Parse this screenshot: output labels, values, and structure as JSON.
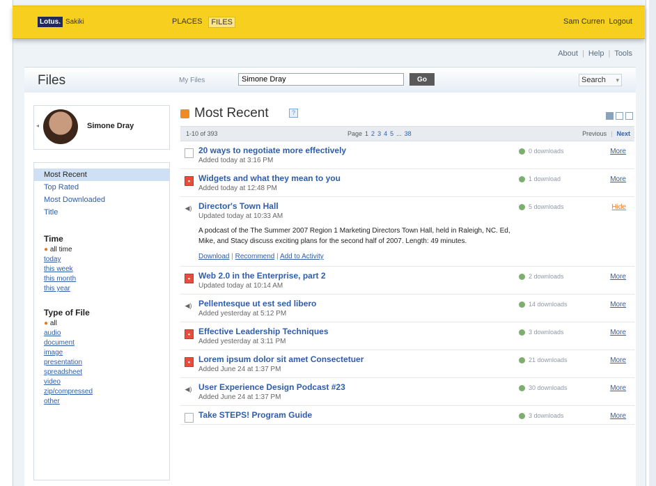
{
  "header": {
    "logo_brand": "Lotus.",
    "logo_product": "Sakiki",
    "nav": [
      {
        "label": "PLACES",
        "active": false
      },
      {
        "label": "FILES",
        "active": true
      }
    ],
    "user_name": "Sam Curren",
    "logout": "Logout"
  },
  "util_links": [
    "About",
    "Help",
    "Tools"
  ],
  "titlebar": {
    "title": "Files",
    "my_files": "My Files",
    "search_value": "Simone Dray",
    "go": "Go",
    "search": "Search"
  },
  "profile": {
    "name": "Simone Dray"
  },
  "sidebar": {
    "nav": [
      "Most Recent",
      "Top Rated",
      "Most Downloaded",
      "Title"
    ],
    "selected_nav": "Most Recent",
    "time": {
      "heading": "Time",
      "current": "all time",
      "links": [
        "today",
        "this week",
        "this month",
        "this year"
      ]
    },
    "type": {
      "heading": "Type of File",
      "current": "all",
      "links": [
        "audio",
        "document",
        "image",
        "presentation",
        "spreadsheet",
        "video",
        "zip/compressed",
        "other"
      ]
    }
  },
  "main": {
    "title": "Most Recent",
    "pager": {
      "count": "1-10 of 393",
      "page_label": "Page",
      "pages": [
        "1",
        "2",
        "3",
        "4",
        "5",
        "...",
        "38"
      ],
      "previous": "Previous",
      "next": "Next"
    },
    "files": [
      {
        "title": "20 ways to negotiate more effectively",
        "sub": "Added today at 3:16 PM",
        "downloads": "0 downloads",
        "action": "More",
        "icon": "document-icon"
      },
      {
        "title": "Widgets and what they mean to you",
        "sub": "Added today at 12:48 PM",
        "downloads": "1 download",
        "action": "More",
        "icon": "presentation-icon"
      },
      {
        "title": "Director's Town Hall",
        "sub": "Updated today at 10:33 AM",
        "downloads": "5 downloads",
        "action": "Hide",
        "icon": "audio-icon",
        "description": "A podcast of the The Summer 2007 Region 1 Marketing Directors Town Hall, held in Raleigh, NC. Ed, Mike, and Stacy discuss exciting plans for the second half of 2007. Length: 49 minutes.",
        "links": [
          "Download",
          "Recommend",
          "Add to Activity"
        ]
      },
      {
        "title": "Web 2.0 in the Enterprise, part 2",
        "sub": "Updated today at 10:14 AM",
        "downloads": "2 downloads",
        "action": "More",
        "icon": "presentation-icon"
      },
      {
        "title": "Pellentesque ut est sed libero",
        "sub": "Added yesterday at 5:12 PM",
        "downloads": "14 downloads",
        "action": "More",
        "icon": "audio-icon"
      },
      {
        "title": "Effective Leadership Techniques",
        "sub": "Added yesterday at 3:11 PM",
        "downloads": "3 downloads",
        "action": "More",
        "icon": "presentation-icon"
      },
      {
        "title": "Lorem ipsum dolor sit amet Consectetuer",
        "sub": "Added June 24 at 1:37 PM",
        "downloads": "21 downloads",
        "action": "More",
        "icon": "presentation-icon"
      },
      {
        "title": "User Experience Design Podcast #23",
        "sub": "Added June 24 at 1:37 PM",
        "downloads": "30 downloads",
        "action": "More",
        "icon": "audio-icon"
      },
      {
        "title": "Take STEPS! Program Guide",
        "sub": "",
        "downloads": "3 downloads",
        "action": "More",
        "icon": "document-icon"
      }
    ]
  },
  "colors": {
    "topbar": "#f6cf1f",
    "link": "#2f5ea8",
    "accent": "#e67a1f"
  }
}
